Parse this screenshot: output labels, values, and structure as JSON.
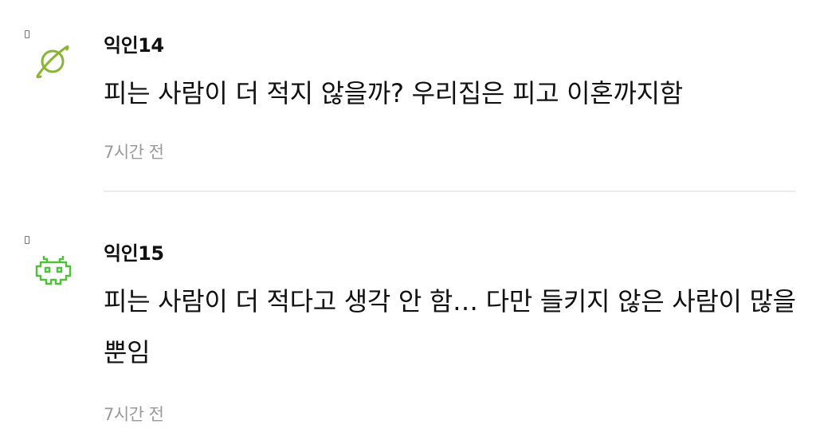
{
  "comments": [
    {
      "author": "익인14",
      "text": "피는 사람이 더 적지 않을까? 우리집은 피고 이혼까지함",
      "time": "7시간 전",
      "avatar_icon": "planet-icon",
      "avatar_color": "#8ab533"
    },
    {
      "author": "익인15",
      "text": "피는 사람이 더 적다고 생각 안 함… 다만 들키지 않은 사람이 많을뿐임",
      "time": "7시간 전",
      "avatar_icon": "space-invader-icon",
      "avatar_color": "#4fc13b"
    }
  ]
}
